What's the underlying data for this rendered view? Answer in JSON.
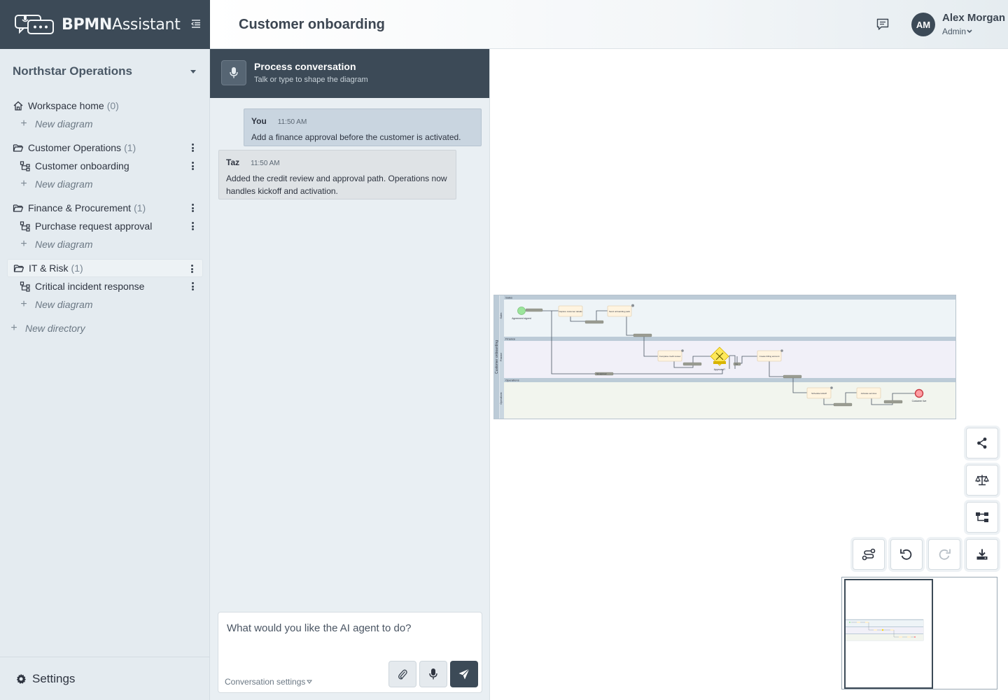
{
  "brand": {
    "name_bold": "BPMN",
    "name_rest": "Assistant"
  },
  "workspace": {
    "name": "Northstar Operations"
  },
  "tree": {
    "home": {
      "label": "Workspace home",
      "count": "(0)",
      "new_diagram": "New diagram"
    },
    "directories": [
      {
        "label": "Customer Operations",
        "count": "(1)",
        "diagrams": [
          "Customer onboarding"
        ],
        "new_diagram": "New diagram"
      },
      {
        "label": "Finance & Procurement",
        "count": "(1)",
        "diagrams": [
          "Purchase request approval"
        ],
        "new_diagram": "New diagram"
      },
      {
        "label": "IT & Risk",
        "count": "(1)",
        "diagrams": [
          "Critical incident response"
        ],
        "new_diagram": "New diagram"
      }
    ],
    "new_directory": "New directory"
  },
  "settings": {
    "label": "Settings"
  },
  "header": {
    "title": "Customer onboarding",
    "user_initials": "AM",
    "user_name": "Alex Morgan",
    "user_role": "Admin"
  },
  "chat": {
    "title": "Process conversation",
    "subtitle": "Talk or type to shape the diagram",
    "messages": [
      {
        "author": "You",
        "time": "11:50 AM",
        "text": "Add a finance approval before the customer is activated."
      },
      {
        "author": "Taz",
        "time": "11:50 AM",
        "text": "Added the credit review and approval path. Operations now handles kickoff and activation."
      }
    ],
    "input_placeholder": "What would you like the AI agent to do?",
    "conversation_settings": "Conversation settings"
  },
  "diagram": {
    "pool": "Customer onboarding",
    "lanes": [
      "Sales",
      "Finance",
      "Operations"
    ],
    "start_event": "Agreement signed",
    "tasks": [
      "Capture customer details",
      "Send onboarding pack",
      "Complete credit review",
      "Create billing account",
      "Schedule kickoff",
      "Activate services"
    ],
    "gateway": "Approved?",
    "end_event": "Customer live",
    "flow_labels": [
      "Yes",
      "Not approved"
    ]
  },
  "colors": {
    "brand_dark": "#3c4a57",
    "sidebar_bg": "#e4ebf0",
    "chat_bg": "#e9eff3",
    "start_event": "#9be59b",
    "end_event": "#ff9ea3",
    "gateway": "#ffe95a",
    "task": "#fff4e0"
  },
  "icons": [
    "chat-logo-icon",
    "sidebar-collapse-icon",
    "home-icon",
    "folder-icon",
    "diagram-icon",
    "gear-icon",
    "comment-icon",
    "microphone-icon",
    "paperclip-icon",
    "send-icon",
    "share-icon",
    "scale-icon",
    "hierarchy-icon",
    "route-icon",
    "undo-icon",
    "redo-icon",
    "download-icon"
  ]
}
